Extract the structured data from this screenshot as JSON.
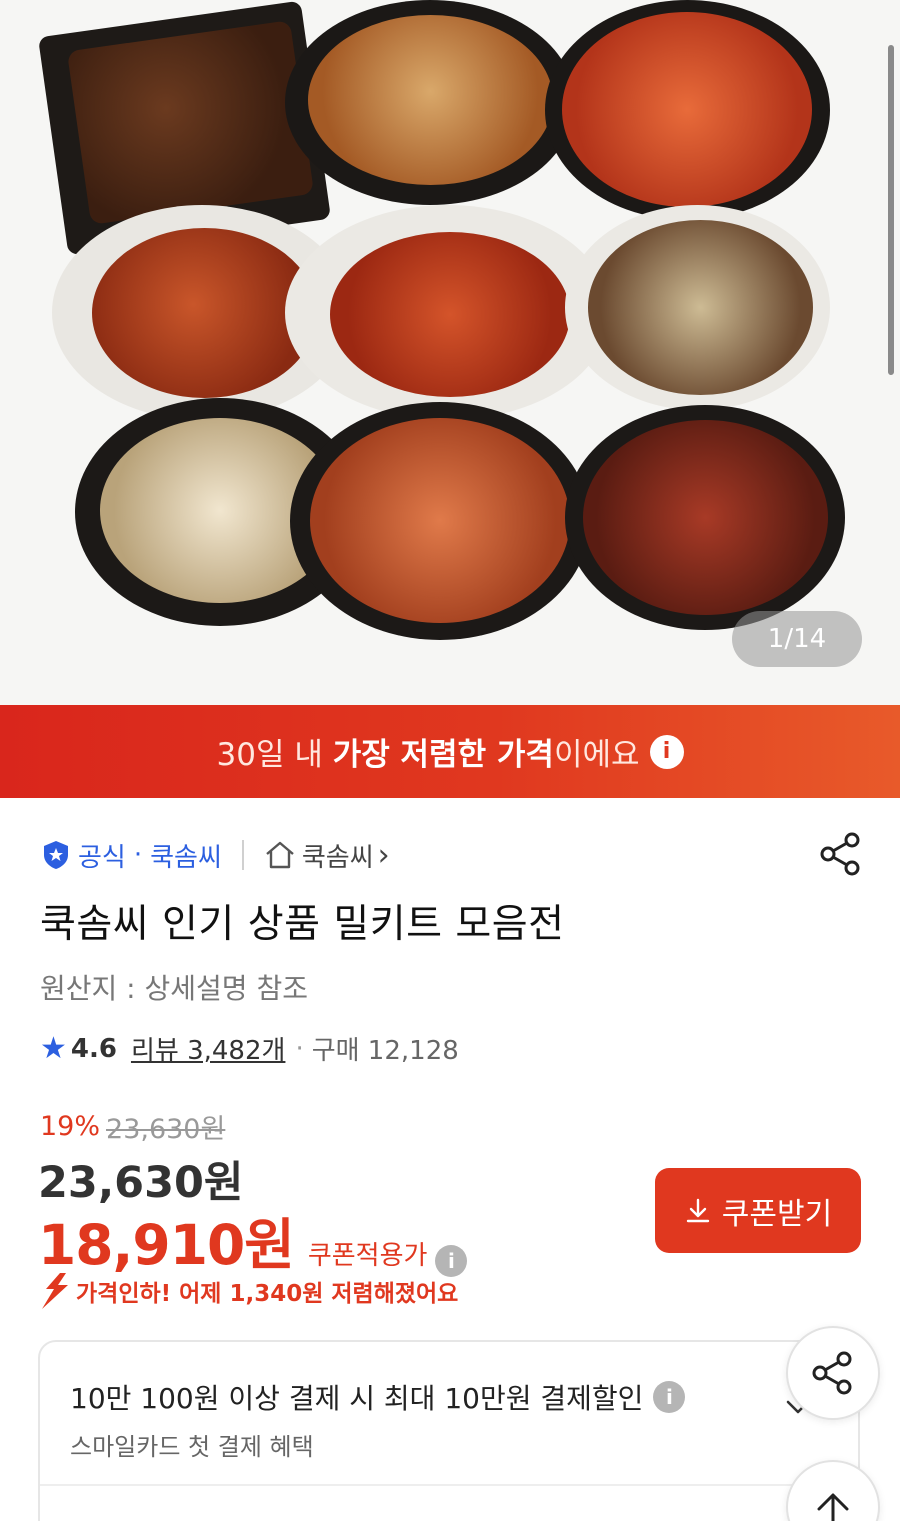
{
  "hero": {
    "image_name": "meal-kit-collection-photo",
    "page_indicator": "1/14"
  },
  "banner": {
    "prefix": "30일 내 ",
    "highlight": "가장 저렴한 가격",
    "suffix": "이에요"
  },
  "seller": {
    "official_label": "공식",
    "separator": "·",
    "brand": "쿡솜씨",
    "store_label": "쿡솜씨",
    "store_chevron": "›"
  },
  "product": {
    "title": "쿡솜씨 인기 상품 밀키트 모음전",
    "origin": "원산지 : 상세설명 참조"
  },
  "rating": {
    "score": "4.6",
    "reviews": "리뷰 3,482개",
    "dot": "·",
    "purchases": "구매 12,128"
  },
  "price": {
    "discount_pct": "19%",
    "original": "23,630원",
    "sale": "23,630원",
    "coupon_price": "18,910원",
    "coupon_label": "쿠폰적용가",
    "coupon_button": "쿠폰받기",
    "price_drop": "가격인하! 어제 1,340원 저렴해졌어요"
  },
  "promo": {
    "line1": "10만 100원 이상 결제 시 최대 10만원 결제할인",
    "line2": "스마일카드 첫 결제 혜택"
  },
  "colors": {
    "accent": "#e0381f",
    "official_blue": "#2c5fe0"
  },
  "icons": {
    "share": "share-icon",
    "home": "home-icon",
    "star": "star-icon",
    "info": "info-icon",
    "download": "download-icon",
    "arrow_up": "arrow-up-icon",
    "chevron_down": "chevron-down-icon"
  }
}
